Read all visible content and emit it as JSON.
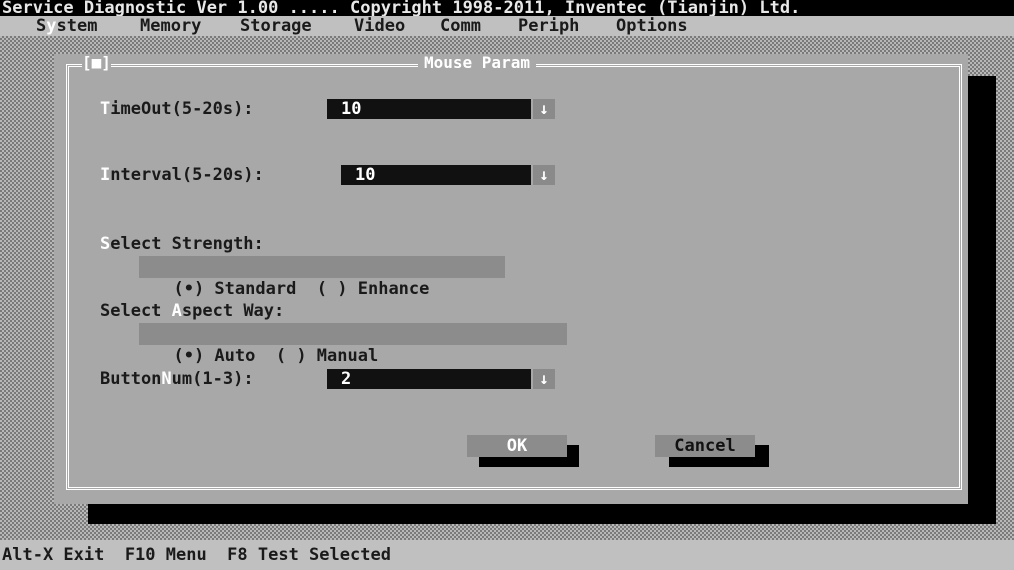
{
  "title_bar": "Service Diagnostic Ver 1.00 ..... Copyright 1998-2011, Inventec (Tianjin) Ltd.",
  "menu": {
    "items": [
      {
        "pre": "S",
        "hot": "y",
        "post": "stem"
      },
      {
        "label": "Memory"
      },
      {
        "label": "Storage"
      },
      {
        "label": "Video"
      },
      {
        "label": "Comm"
      },
      {
        "label": "Periph"
      },
      {
        "label": "Options"
      }
    ]
  },
  "dialog": {
    "title": "Mouse Param",
    "close_box": "[■]",
    "timeout": {
      "hot": "T",
      "rest": "imeOut(5-20s):",
      "value": "10"
    },
    "interval": {
      "hot": "I",
      "rest": "nterval(5-20s):",
      "value": "10"
    },
    "strength": {
      "hot": "S",
      "rest": "elect Strength:",
      "options": [
        "(•) Standard",
        "( ) Enhance"
      ]
    },
    "aspect": {
      "pre": "Select ",
      "hot": "A",
      "rest": "spect Way:",
      "options": [
        "(•) Auto",
        "( ) Manual"
      ]
    },
    "buttonnum": {
      "pre": "Button",
      "hot": "N",
      "rest": "um(1-3):",
      "value": "2"
    },
    "dropdown_arrow": "↓",
    "ok_label": "OK",
    "cancel_label": "Cancel"
  },
  "status_bar": "Alt-X Exit  F10 Menu  F8 Test Selected"
}
